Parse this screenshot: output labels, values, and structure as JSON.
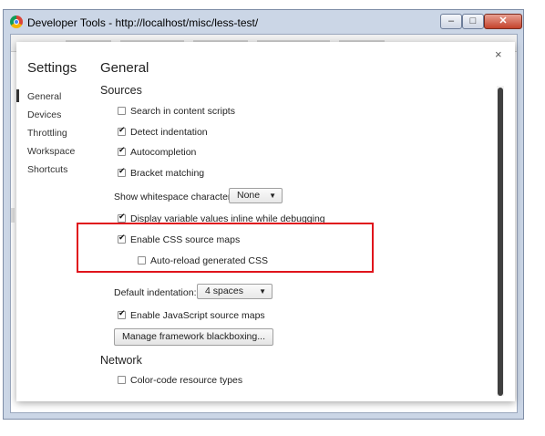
{
  "window": {
    "title": "Developer Tools - http://localhost/misc/less-test/",
    "min_label": "–",
    "max_label": "□",
    "close_label": "✕"
  },
  "dialog": {
    "title": "Settings",
    "section_title": "General",
    "close_label": "×"
  },
  "nav": [
    {
      "label": "General",
      "active": true
    },
    {
      "label": "Devices"
    },
    {
      "label": "Throttling"
    },
    {
      "label": "Workspace"
    },
    {
      "label": "Shortcuts"
    }
  ],
  "sources": {
    "heading": "Sources",
    "search_in_content_scripts": {
      "label": "Search in content scripts",
      "checked": false
    },
    "detect_indentation": {
      "label": "Detect indentation",
      "checked": true
    },
    "autocompletion": {
      "label": "Autocompletion",
      "checked": true
    },
    "bracket_matching": {
      "label": "Bracket matching",
      "checked": true
    },
    "show_whitespace": {
      "label": "Show whitespace characters:",
      "value": "None"
    },
    "display_variable_values": {
      "label": "Display variable values inline while debugging",
      "checked": true
    },
    "enable_css_source_maps": {
      "label": "Enable CSS source maps",
      "checked": true
    },
    "auto_reload_css": {
      "label": "Auto-reload generated CSS",
      "checked": false
    },
    "default_indentation": {
      "label": "Default indentation:",
      "value": "4 spaces"
    },
    "enable_js_source_maps": {
      "label": "Enable JavaScript source maps",
      "checked": true
    },
    "blackboxing_button": "Manage framework blackboxing..."
  },
  "network": {
    "heading": "Network",
    "color_code_resource_types": {
      "label": "Color-code resource types",
      "checked": false
    }
  },
  "colors": {
    "highlight_border": "#e0141c",
    "scrollbar_thumb": "#404040"
  }
}
